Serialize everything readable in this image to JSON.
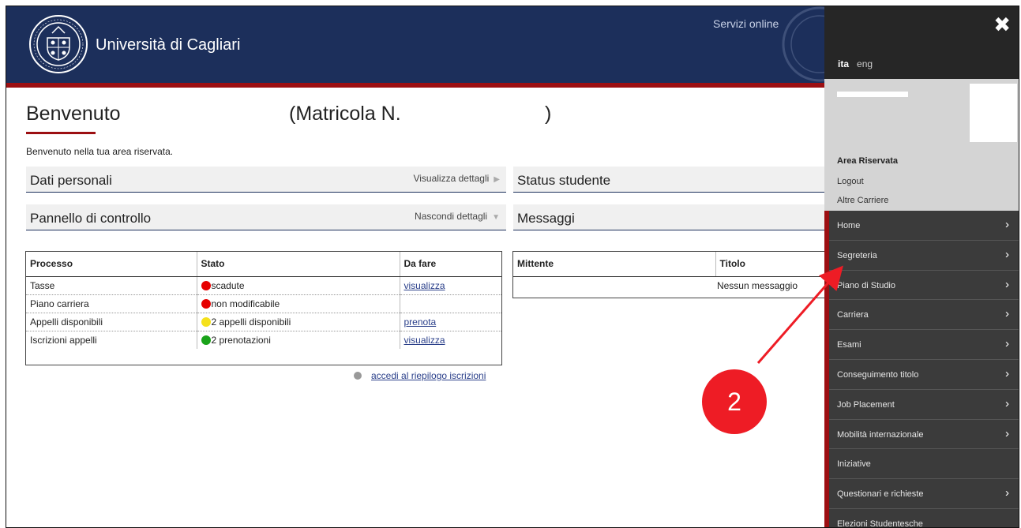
{
  "header": {
    "university_name": "Università di Cagliari",
    "servizi_label": "Servizi online"
  },
  "page": {
    "title": "Benvenuto",
    "matricola_label": "(Matricola N.",
    "matricola_close": ")",
    "welcome_text": "Benvenuto nella tua area riservata."
  },
  "panels": {
    "dati_personali": {
      "title": "Dati personali",
      "link": "Visualizza dettagli"
    },
    "pannello": {
      "title": "Pannello di controllo",
      "link": "Nascondi dettagli"
    },
    "status": {
      "title": "Status studente"
    },
    "messaggi": {
      "title": "Messaggi"
    }
  },
  "process_table": {
    "headers": [
      "Processo",
      "Stato",
      "Da fare"
    ],
    "rows": [
      {
        "processo": "Tasse",
        "stato": "scadute",
        "stato_color": "#e60000",
        "azione": "visualizza"
      },
      {
        "processo": "Piano carriera",
        "stato": "non modificabile",
        "stato_color": "#e60000",
        "azione": ""
      },
      {
        "processo": "Appelli disponibili",
        "stato": "2 appelli disponibili",
        "stato_color": "#f5e11b",
        "azione": "prenota"
      },
      {
        "processo": "Iscrizioni appelli",
        "stato": "2 prenotazioni",
        "stato_color": "#1aa31a",
        "azione": "visualizza"
      }
    ],
    "riepilogo_link": "accedi al riepilogo iscrizioni"
  },
  "messages_table": {
    "headers": [
      "Mittente",
      "Titolo"
    ],
    "empty_text": "Nessun messaggio"
  },
  "side_menu": {
    "close_icon": "close-icon",
    "languages": {
      "active": "ita",
      "other": "eng"
    },
    "area_riservata": "Area Riservata",
    "logout": "Logout",
    "altre_carriere": "Altre Carriere",
    "items": [
      {
        "label": "Home",
        "has_arrow": true
      },
      {
        "label": "Segreteria",
        "has_arrow": true
      },
      {
        "label": "Piano di Studio",
        "has_arrow": true
      },
      {
        "label": "Carriera",
        "has_arrow": true
      },
      {
        "label": "Esami",
        "has_arrow": true
      },
      {
        "label": "Conseguimento titolo",
        "has_arrow": true
      },
      {
        "label": "Job Placement",
        "has_arrow": true
      },
      {
        "label": "Mobilità internazionale",
        "has_arrow": true
      },
      {
        "label": "Iniziative",
        "has_arrow": false
      },
      {
        "label": "Questionari e richieste",
        "has_arrow": true
      },
      {
        "label": "Elezioni Studentesche",
        "has_arrow": false
      }
    ]
  },
  "annotation": {
    "badge_number": "2",
    "color": "#ee1c25"
  },
  "colors": {
    "header_navy": "#1c2f5b",
    "accent_red": "#9c0f12",
    "menu_dark": "#3b3b3b"
  }
}
